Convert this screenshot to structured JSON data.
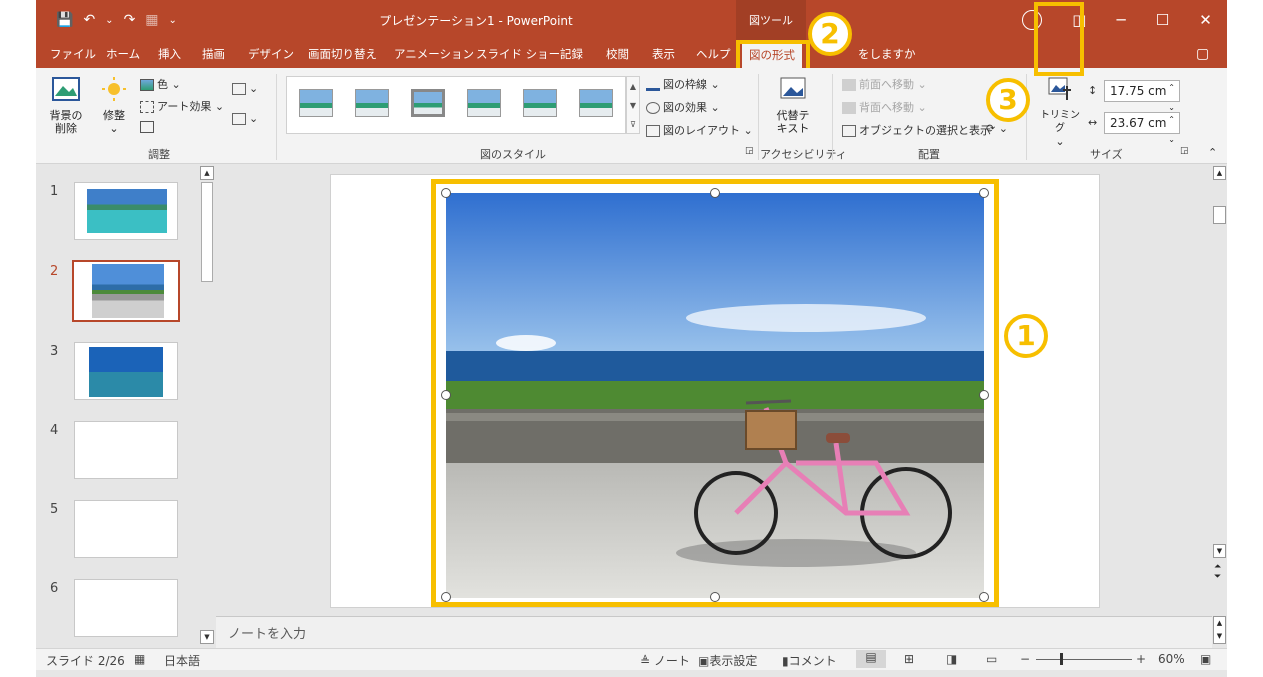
{
  "titlebar": {
    "doc_title": "プレゼンテーション1  -  PowerPoint",
    "tools_context": "図ツール",
    "qat_dropdown": "⌄",
    "minimize": "─",
    "restore": "☐",
    "close": "✕"
  },
  "tabs": [
    "ファイル",
    "ホーム",
    "挿入",
    "描画",
    "デザイン",
    "画面切り替え",
    "アニメーション",
    "スライド ショー",
    "記録",
    "校閲",
    "表示",
    "ヘルプ",
    "図の形式",
    "をしますか"
  ],
  "ribbon": {
    "remove_bg": "背景の\n削除",
    "corrections": "修整",
    "color": "色",
    "artistic_effects": "アート効果",
    "adjust_group": "調整",
    "picture_border": "図の枠線",
    "picture_effects": "図の効果",
    "picture_layout": "図のレイアウト",
    "styles_group": "図のスタイル",
    "alt_text": "代替テ\nキスト",
    "accessibility_group": "アクセシビリティ",
    "bring_forward": "前面へ移動",
    "send_backward": "背面へ移動",
    "selection_pane": "オブジェクトの選択と表示",
    "arrange_group": "配置",
    "crop": "トリミング",
    "height": "17.75 cm",
    "width": "23.67 cm",
    "size_group": "サイズ",
    "dropdown_arrow": "⌄"
  },
  "annotations": {
    "one": "1",
    "two": "2",
    "three": "3"
  },
  "slides": [
    {
      "number": "1"
    },
    {
      "number": "2"
    },
    {
      "number": "3"
    },
    {
      "number": "4"
    },
    {
      "number": "5"
    },
    {
      "number": "6"
    }
  ],
  "notes_placeholder": "ノートを入力",
  "statusbar": {
    "slide_info": "スライド 2/26",
    "language": "日本語",
    "notes": "ノート",
    "display_settings": "表示設定",
    "comments": "コメント",
    "zoom_minus": "−",
    "zoom_plus": "+",
    "zoom": "60%"
  },
  "colors": {
    "accent": "#b7472a",
    "highlight": "#f7bf00"
  },
  "icons": {
    "save": "save-icon",
    "undo": "undo-icon",
    "redo": "redo-icon",
    "account": "account-icon",
    "comments": "comments-icon"
  }
}
